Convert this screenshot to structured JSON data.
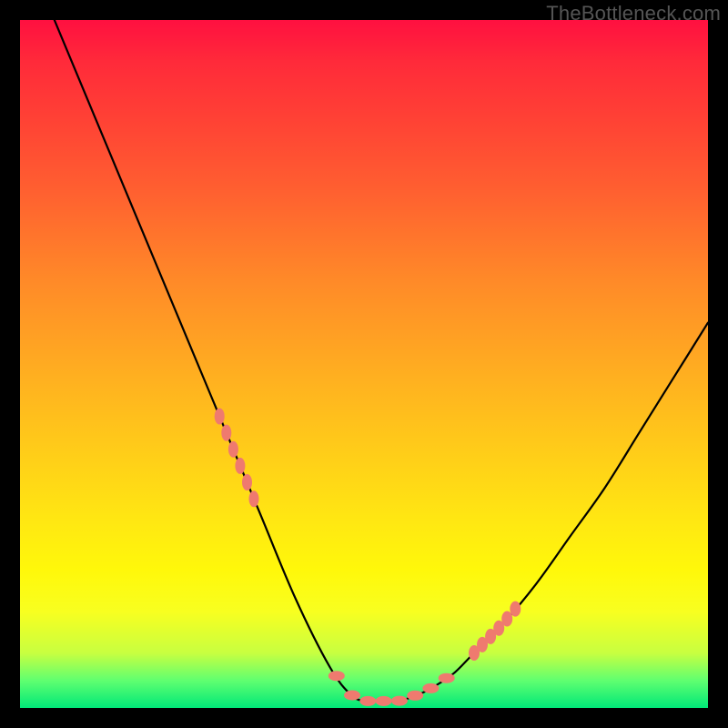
{
  "attribution": "TheBottleneck.com",
  "chart_data": {
    "type": "line",
    "title": "",
    "xlabel": "",
    "ylabel": "",
    "xlim": [
      0,
      100
    ],
    "ylim": [
      0,
      100
    ],
    "series": [
      {
        "name": "bottleneck-curve",
        "color": "#000000",
        "x": [
          5,
          10,
          15,
          20,
          25,
          30,
          35,
          40,
          45,
          48,
          50,
          52,
          55,
          58,
          60,
          63,
          66,
          70,
          75,
          80,
          85,
          90,
          95,
          100
        ],
        "values": [
          100,
          88,
          76,
          64,
          52,
          40,
          28,
          16,
          6,
          2,
          1,
          1,
          1,
          2,
          3,
          5,
          8,
          12,
          18,
          25,
          32,
          40,
          48,
          56
        ]
      }
    ],
    "markers": {
      "name": "highlighted-points",
      "color": "#ef7a6f",
      "segments": [
        {
          "side": "left",
          "x_range": [
            29,
            34
          ],
          "y_range": [
            22,
            34
          ]
        },
        {
          "side": "floor",
          "x_range": [
            46,
            62
          ],
          "y_range": [
            1,
            3
          ]
        },
        {
          "side": "right",
          "x_range": [
            66,
            72
          ],
          "y_range": [
            9,
            16
          ]
        }
      ]
    },
    "gradient_stops": [
      {
        "pos": 0,
        "color": "#ff1040"
      },
      {
        "pos": 25,
        "color": "#ff6030"
      },
      {
        "pos": 52,
        "color": "#ffb020"
      },
      {
        "pos": 80,
        "color": "#fff80a"
      },
      {
        "pos": 100,
        "color": "#00e878"
      }
    ]
  }
}
